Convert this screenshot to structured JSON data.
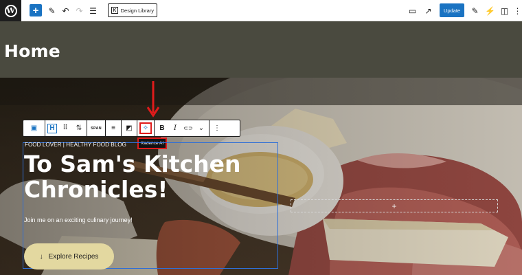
{
  "topbar": {
    "wp_logo": "W",
    "add_label": "+",
    "tools_icon": "✎",
    "undo_icon": "↶",
    "redo_icon": "↷",
    "list_view_icon": "☰",
    "design_library_label": "Design Library",
    "design_library_logo": "K",
    "preview_icon": "▭",
    "view_post_icon": "↗",
    "update_label": "Update",
    "right_icons": [
      "✎",
      "⚡",
      "◫",
      "⋮"
    ]
  },
  "page": {
    "title": "Home"
  },
  "block_toolbar": {
    "image_icon": "▣",
    "heading_icon": "H",
    "drag_icon": "⠿",
    "move_icon": "⇅",
    "span_label": "SPAN",
    "align_icon": "≡",
    "dynamic_icon": "◩",
    "ai_icon": "✧",
    "bold_label": "B",
    "italic_label": "I",
    "link_icon": "⊂⊃",
    "more_rich_icon": "⌄",
    "options_icon": "⋮"
  },
  "tooltip": {
    "label": "Kadence AI"
  },
  "hero": {
    "eyebrow": "FOOD LOVER | HEALTHY FOOD BLOG",
    "headline": "To Sam's Kitchen Chronicles!",
    "subtext": "Join me on an exciting culinary journey!",
    "cta_label": "Explore Recipes",
    "cta_icon": "↓",
    "empty_block_icon": "+"
  },
  "colors": {
    "accent": "#1a73c2",
    "highlight": "#e01b1b",
    "cta": "#e3d8a0",
    "title_band": "#4a4a3f"
  }
}
